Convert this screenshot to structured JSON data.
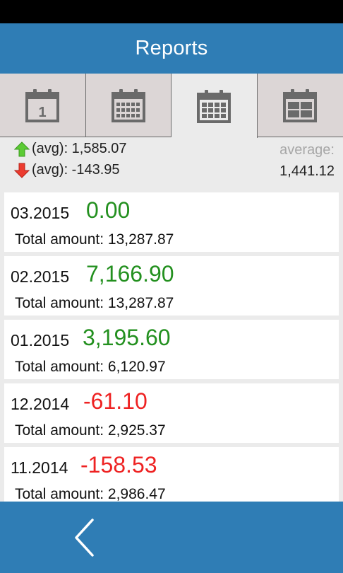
{
  "header": {
    "title": "Reports"
  },
  "tabs": [
    {
      "name": "day",
      "icon": "calendar-day-icon",
      "day_number": "1",
      "active": false
    },
    {
      "name": "week",
      "icon": "calendar-week-icon",
      "active": false
    },
    {
      "name": "month",
      "icon": "calendar-month-icon",
      "active": true
    },
    {
      "name": "year",
      "icon": "calendar-year-icon",
      "active": false
    }
  ],
  "summary": {
    "up_icon": "green-up-arrow-icon",
    "up_label": "(avg): 1,585.07",
    "down_icon": "red-down-arrow-icon",
    "down_label": "(avg): -143.95",
    "average_label": "average:",
    "average_value": "1,441.12"
  },
  "reports": [
    {
      "period": "03.2015",
      "delta": "0.00",
      "sign": "positive",
      "total": "Total amount: 13,287.87"
    },
    {
      "period": "02.2015",
      "delta": "7,166.90",
      "sign": "positive",
      "total": "Total amount: 13,287.87"
    },
    {
      "period": "01.2015",
      "delta": "3,195.60",
      "sign": "positive",
      "total": "Total amount: 6,120.97"
    },
    {
      "period": "12.2014",
      "delta": "-61.10",
      "sign": "negative",
      "total": "Total amount: 2,925.37"
    },
    {
      "period": "11.2014",
      "delta": "-158.53",
      "sign": "negative",
      "total": "Total amount: 2,986.47"
    }
  ],
  "footer": {
    "back_icon": "chevron-left-icon"
  },
  "colors": {
    "accent": "#2f7db5",
    "positive": "#23901f",
    "negative": "#ee2222",
    "muted": "#a7a7a7"
  }
}
